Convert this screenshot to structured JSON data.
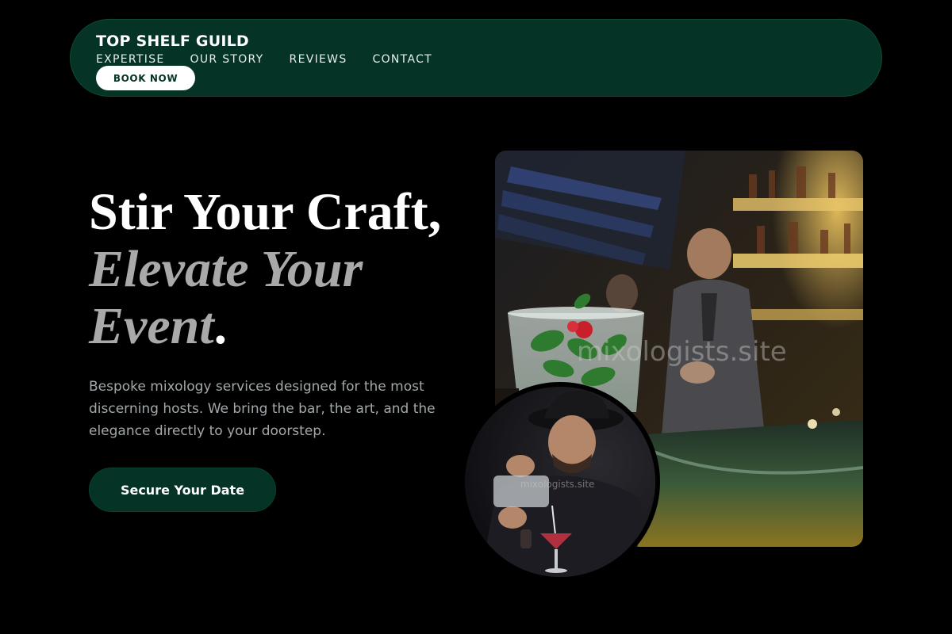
{
  "nav": {
    "brand": "TOP SHELF GUILD",
    "links": [
      "EXPERTISE",
      "OUR STORY",
      "REVIEWS",
      "CONTACT"
    ],
    "book_label": "BOOK NOW"
  },
  "hero": {
    "title_line1": "Stir Your Craft,",
    "title_line2": "Elevate Your Event",
    "title_period": ".",
    "description": "Bespoke mixology services designed for the most discerning hosts. We bring the bar, the art, and the elegance directly to your doorstep.",
    "cta_label": "Secure Your Date"
  },
  "images": {
    "main_watermark": "mixologists.site",
    "circle_watermark": "mixologists.site"
  },
  "colors": {
    "brand_green": "#053325",
    "background": "#000000",
    "muted_text": "#a3a8aa"
  }
}
